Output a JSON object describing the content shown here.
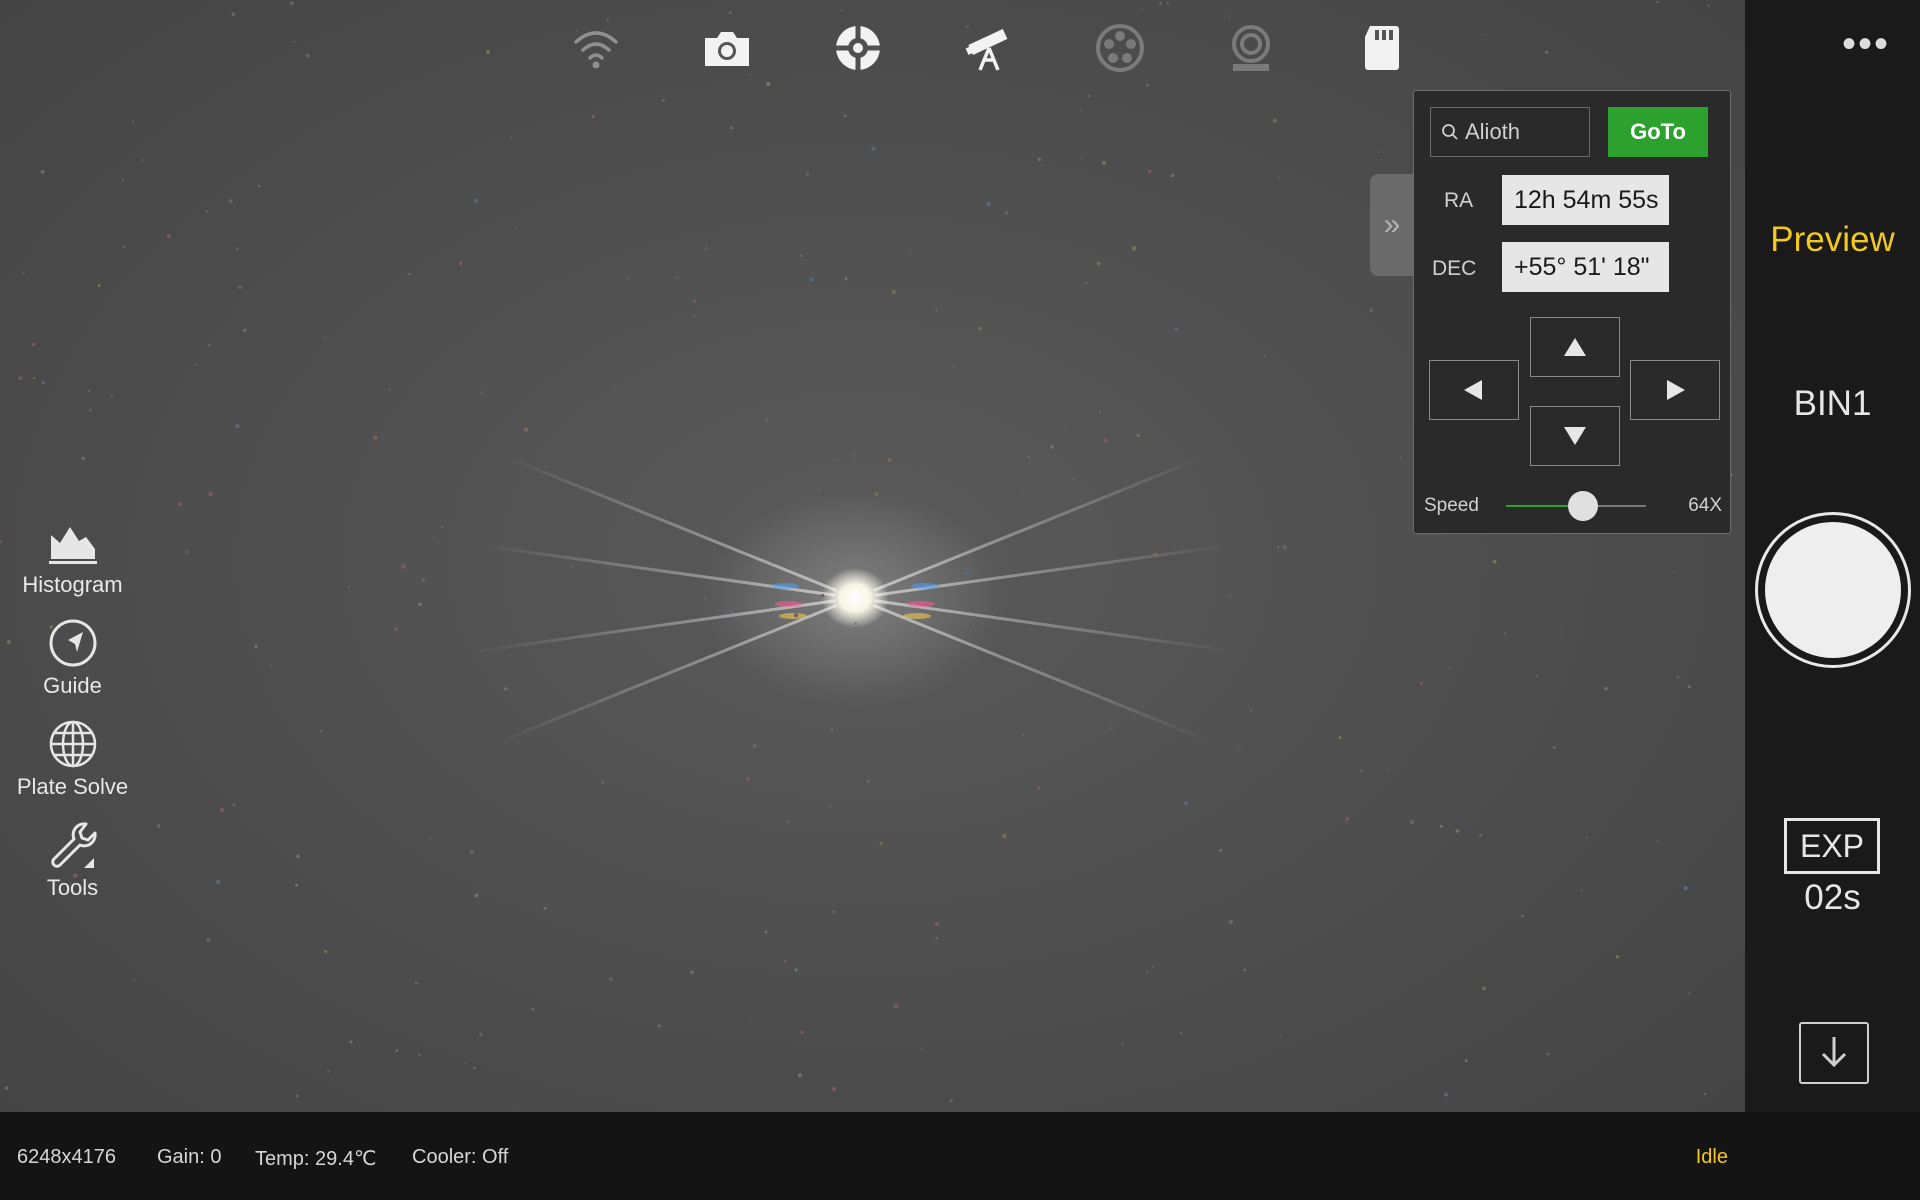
{
  "top_icons": [
    {
      "name": "wifi-icon",
      "state": "dim"
    },
    {
      "name": "camera-icon",
      "state": "active"
    },
    {
      "name": "crosshair-icon",
      "state": "active"
    },
    {
      "name": "telescope-icon",
      "state": "active"
    },
    {
      "name": "filter-wheel-icon",
      "state": "dim"
    },
    {
      "name": "focuser-icon",
      "state": "dim"
    },
    {
      "name": "sd-card-icon",
      "state": "active"
    }
  ],
  "left_menu": [
    {
      "icon": "histogram-icon",
      "label": "Histogram"
    },
    {
      "icon": "guide-icon",
      "label": "Guide"
    },
    {
      "icon": "globe-icon",
      "label": "Plate Solve"
    },
    {
      "icon": "wrench-icon",
      "label": "Tools"
    }
  ],
  "goto_panel": {
    "search_value": "Alioth",
    "goto_label": "GoTo",
    "ra_label": "RA",
    "ra_value": "12h 54m 55s",
    "dec_label": "DEC",
    "dec_value": "+55° 51' 18\"",
    "speed_label": "Speed",
    "speed_value": "64X",
    "speed_fraction": 0.55,
    "collapse_icon": "double-chevron-right-icon"
  },
  "right_bar": {
    "more_icon": "more-dots-icon",
    "mode": "Preview",
    "bin": "BIN1",
    "exp_label": "EXP",
    "exp_value": "02s",
    "download_icon": "download-icon"
  },
  "status": {
    "resolution": "6248x4176",
    "gain": "Gain: 0",
    "temp": "Temp: 29.4℃",
    "cooler": "Cooler: Off",
    "state": "Idle"
  },
  "colors": {
    "accent": "#f3c81f",
    "go": "#2da12d"
  }
}
